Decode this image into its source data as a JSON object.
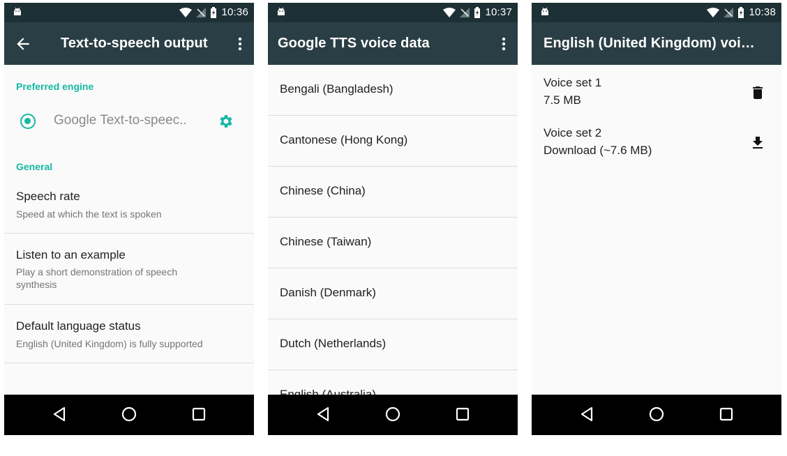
{
  "colors": {
    "accent": "#15b8a4",
    "appbar": "#2a3f45",
    "statusbar": "#1d3036",
    "navbar": "#000000"
  },
  "phone1": {
    "status_time": "10:36",
    "title": "Text-to-speech output",
    "preferred_header": "Preferred engine",
    "engine_label": "Google Text-to-speec..",
    "general_header": "General",
    "prefs": [
      {
        "title": "Speech rate",
        "summary": "Speed at which the text is spoken"
      },
      {
        "title": "Listen to an example",
        "summary": "Play a short demonstration of speech synthesis"
      },
      {
        "title": "Default language status",
        "summary": "English (United Kingdom) is fully supported"
      }
    ]
  },
  "phone2": {
    "status_time": "10:37",
    "title": "Google TTS voice data",
    "languages": [
      "Bengali (Bangladesh)",
      "Cantonese (Hong Kong)",
      "Chinese (China)",
      "Chinese (Taiwan)",
      "Danish (Denmark)",
      "Dutch (Netherlands)",
      "English (Australia)"
    ]
  },
  "phone3": {
    "status_time": "10:38",
    "title": "English (United Kingdom) voi…",
    "voices": [
      {
        "title": "Voice set 1",
        "subtitle": "7.5 MB",
        "action_icon": "delete-icon"
      },
      {
        "title": "Voice set 2",
        "subtitle": "Download (~7.6 MB)",
        "action_icon": "download-icon"
      }
    ]
  },
  "navbar": {
    "icons": [
      "back-nav-icon",
      "home-nav-icon",
      "recents-nav-icon"
    ]
  }
}
